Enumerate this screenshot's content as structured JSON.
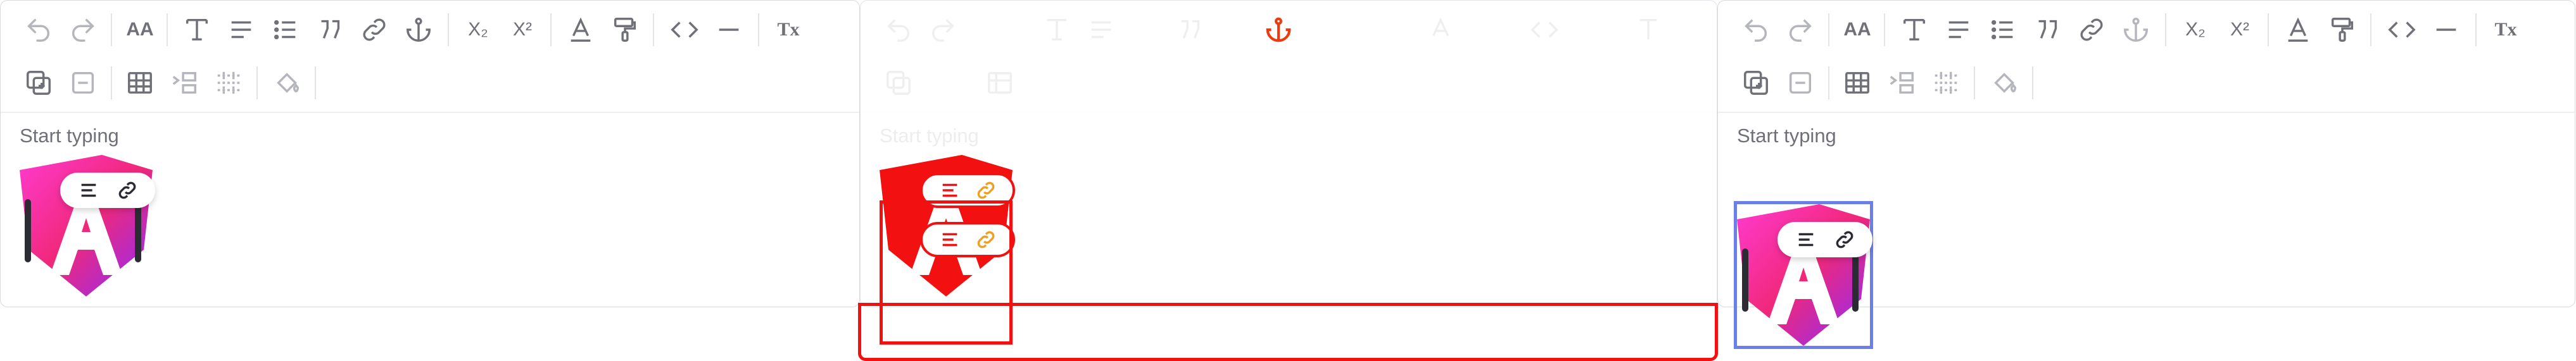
{
  "editor": {
    "placeholder": "Start typing",
    "toolbar_row1": [
      {
        "icon": "undo-icon"
      },
      {
        "icon": "redo-icon"
      },
      {
        "icon": "font-size-icon",
        "text": "AA"
      },
      {
        "icon": "text-style-icon"
      },
      {
        "icon": "align-icon"
      },
      {
        "icon": "bullet-list-icon"
      },
      {
        "icon": "blockquote-icon"
      },
      {
        "icon": "link-icon"
      },
      {
        "icon": "anchor-icon"
      },
      {
        "icon": "subscript-icon",
        "text": "X₂"
      },
      {
        "icon": "superscript-icon",
        "text": "X²"
      },
      {
        "icon": "text-color-icon"
      },
      {
        "icon": "paint-format-icon"
      },
      {
        "icon": "code-icon"
      },
      {
        "icon": "horizontal-rule-icon"
      },
      {
        "icon": "clear-format-icon",
        "text": "Tx"
      }
    ],
    "toolbar_row2": [
      {
        "icon": "add-block-icon"
      },
      {
        "icon": "remove-block-icon"
      },
      {
        "icon": "table-icon"
      },
      {
        "icon": "indent-icon"
      },
      {
        "icon": "grid-icon"
      },
      {
        "icon": "fill-color-icon"
      }
    ],
    "image_toolbar": [
      "align-left-icon",
      "image-link-icon"
    ]
  },
  "colors": {
    "icon": "#8a8b95",
    "icon_dark": "#2b2b33",
    "highlight": "#f21010",
    "selection": "#6b7fe8",
    "anchor_active": "#ec3b10"
  }
}
